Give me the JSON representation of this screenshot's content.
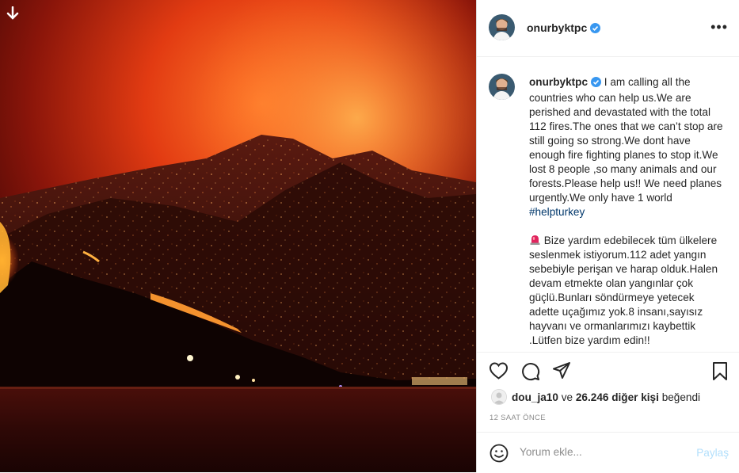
{
  "post": {
    "username": "onurbyktpc",
    "verified": true,
    "caption_en": "I am calling all the countries who can help us.We are perished and devastated with the total 112 fires.The ones that we can’t stop are still going so strong.We dont have enough fire fighting planes to stop it.We lost 8 people ,so many animals and our forests.Please help us!! We need planes urgently.We only have 1 world",
    "hashtag": "#helpturkey",
    "caption_tr": "Bize yardım edebilecek tüm ülkelere seslenmek istiyorum.112 adet yangın sebebiyle perişan ve harap olduk.Halen devam etmekte olan yangınlar çok güçlü.Bunları söndürmeye yetecek adette uçağımız yok.8 insanı,sayısız hayvanı ve ormanlarımızı kaybettik .Lütfen bize yardım edin!!",
    "siren_emoji": "siren-icon"
  },
  "likes": {
    "liker": "dou_ja10",
    "connector": "ve",
    "others_count": "26.246 diğer kişi",
    "suffix": "beğendi"
  },
  "timestamp": "12 SAAT ÖNCE",
  "comment": {
    "placeholder": "Yorum ekle...",
    "post_label": "Paylaş"
  },
  "icons": {
    "download": "download-arrow-icon",
    "more": "more-options-icon",
    "like": "heart-icon",
    "comment": "comment-bubble-icon",
    "share": "paper-plane-icon",
    "save": "bookmark-icon",
    "emoji": "smiley-icon"
  },
  "colors": {
    "verified": "#3897f0",
    "link": "#00376b",
    "post_disabled": "#b2dffc",
    "muted": "#8e8e8e"
  }
}
